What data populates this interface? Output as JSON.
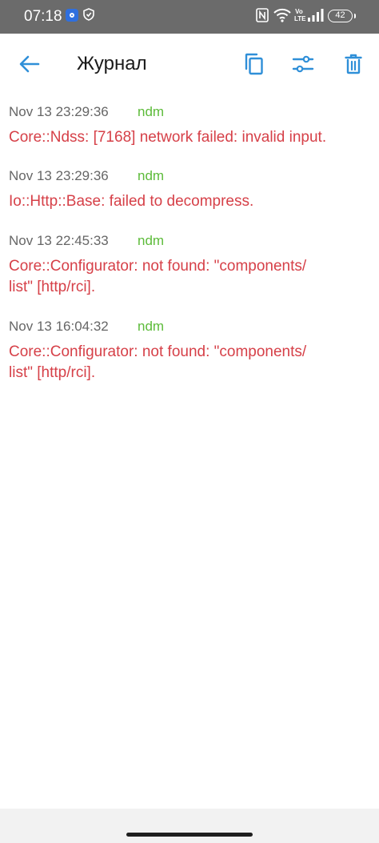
{
  "status_bar": {
    "time": "07:18",
    "volte": "Vo\nLTE",
    "battery": "42",
    "icons": [
      "hotspot-icon",
      "shield-icon",
      "nfc-icon",
      "wifi-icon",
      "signal-icon",
      "battery-icon"
    ]
  },
  "toolbar": {
    "title": "Журнал",
    "accent_color": "#2f8fd8",
    "icons": [
      "back-arrow-icon",
      "copy-icon",
      "filter-icon",
      "delete-icon"
    ]
  },
  "log": {
    "entries": [
      {
        "time": "Nov 13 23:29:36",
        "source": "ndm",
        "message": "Core::Ndss: [7168] network failed: invalid input."
      },
      {
        "time": "Nov 13 23:29:36",
        "source": "ndm",
        "message": "Io::Http::Base: failed to decompress."
      },
      {
        "time": "Nov 13 22:45:33",
        "source": "ndm",
        "message": "Core::Configurator: not found: \"components/\nlist\" [http/rci]."
      },
      {
        "time": "Nov 13 16:04:32",
        "source": "ndm",
        "message": "Core::Configurator: not found: \"components/\nlist\" [http/rci]."
      }
    ],
    "colors": {
      "time": "#666666",
      "source": "#5cbb39",
      "message": "#d64048"
    }
  }
}
